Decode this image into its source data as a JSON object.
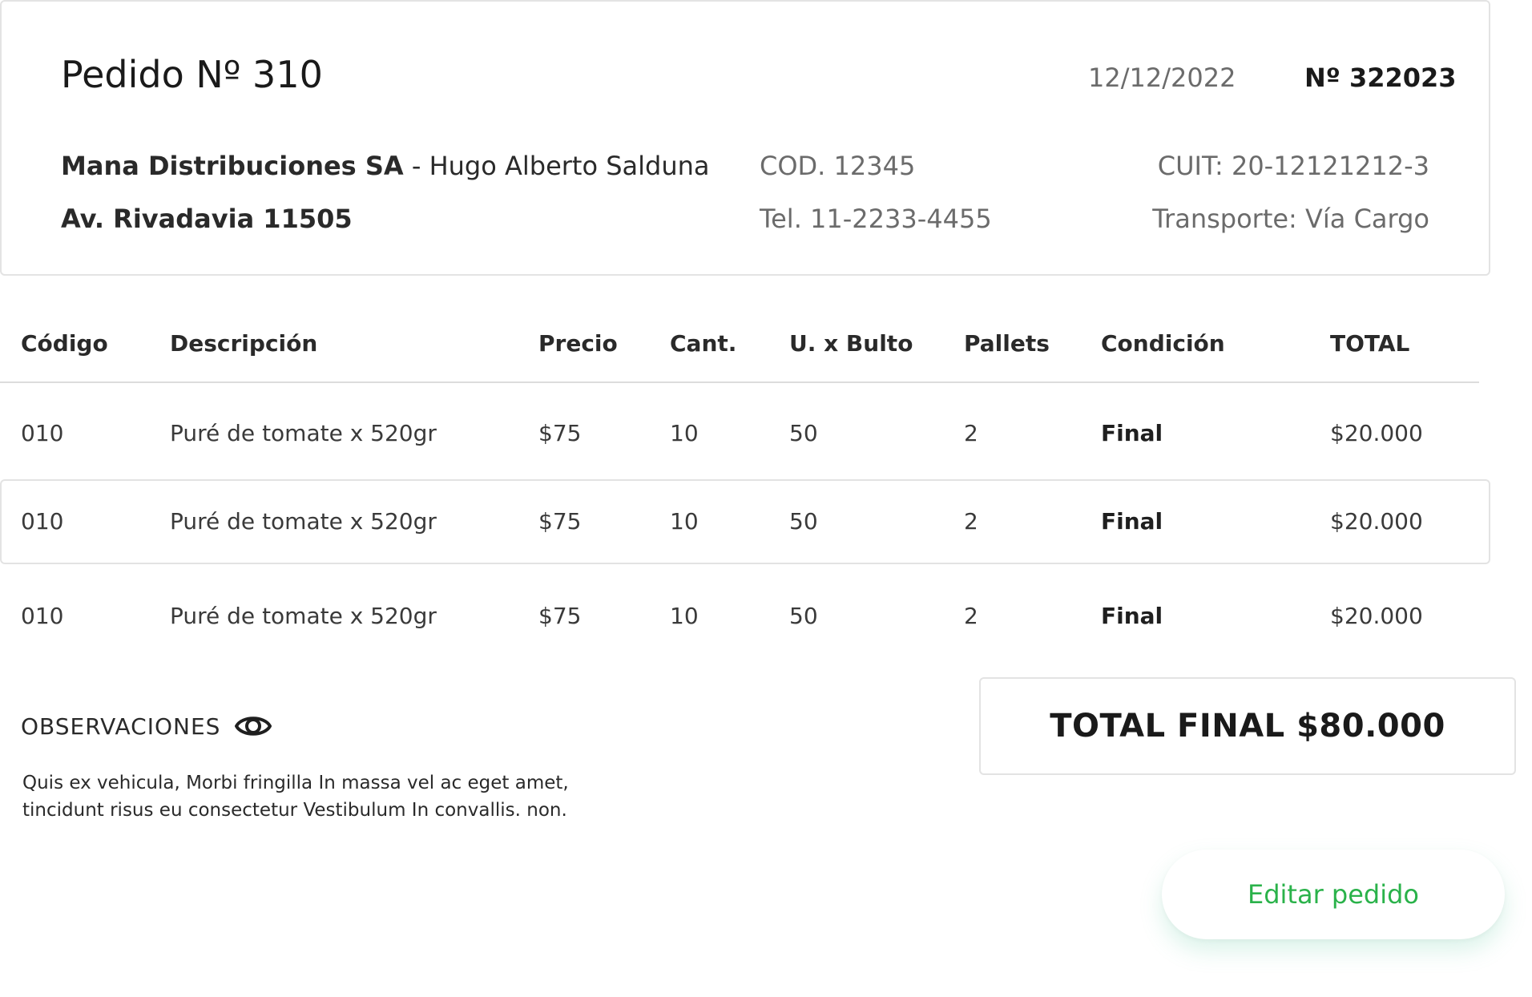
{
  "order": {
    "title": "Pedido Nº 310",
    "date": "12/12/2022",
    "number": "Nº 322023"
  },
  "client": {
    "company": "Mana Distribuciones SA",
    "separator": " - ",
    "contact": "Hugo Alberto Salduna",
    "address": "Av. Rivadavia 11505",
    "code": "COD. 12345",
    "phone": "Tel. 11-2233-4455",
    "cuit": "CUIT: 20-12121212-3",
    "transport": "Transporte: Vía Cargo"
  },
  "table": {
    "headers": [
      "Código",
      "Descripción",
      "Precio",
      "Cant.",
      "U. x Bulto",
      "Pallets",
      "Condición",
      "TOTAL"
    ],
    "rows": [
      [
        "010",
        "Puré de tomate x 520gr",
        "$75",
        "10",
        "50",
        "2",
        "Final",
        "$20.000"
      ],
      [
        "010",
        "Puré de tomate x 520gr",
        "$75",
        "10",
        "50",
        "2",
        "Final",
        "$20.000"
      ],
      [
        "010",
        "Puré de tomate x 520gr",
        "$75",
        "10",
        "50",
        "2",
        "Final",
        "$20.000"
      ]
    ]
  },
  "observations": {
    "label": "OBSERVACIONES",
    "icon": "eye-icon",
    "text_line1": "Quis ex vehicula, Morbi fringilla In massa vel ac eget amet,",
    "text_line2": "tincidunt risus eu consectetur Vestibulum In convallis. non."
  },
  "total_final": "TOTAL FINAL $80.000",
  "actions": {
    "edit_label": "Editar pedido"
  },
  "colors": {
    "accent": "#2ab24a",
    "border": "#e3e3e3",
    "muted_text": "#6b6b6b"
  }
}
